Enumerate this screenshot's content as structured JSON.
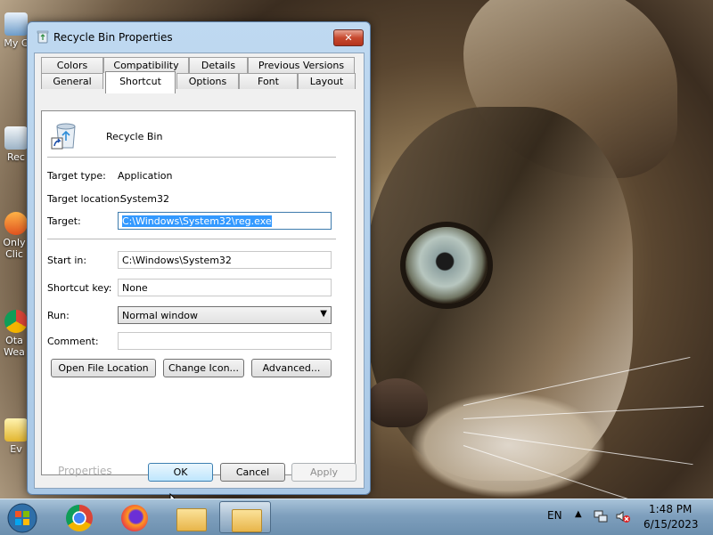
{
  "window": {
    "title": "Recycle Bin Properties",
    "close_label": "✕"
  },
  "tabs": {
    "row1": [
      "Colors",
      "Compatibility",
      "Details",
      "Previous Versions"
    ],
    "row2": [
      "General",
      "Shortcut",
      "Options",
      "Font",
      "Layout"
    ],
    "active": "Shortcut"
  },
  "shortcut": {
    "name": "Recycle Bin",
    "target_type_label": "Target type:",
    "target_type_value": "Application",
    "target_location_label": "Target location:",
    "target_location_value": "System32",
    "target_label": "Target:",
    "target_value": "C:\\Windows\\System32\\reg.exe",
    "start_in_label": "Start in:",
    "start_in_value": "C:\\Windows\\System32",
    "shortcut_key_label": "Shortcut key:",
    "shortcut_key_value": "None",
    "run_label": "Run:",
    "run_value": "Normal window",
    "comment_label": "Comment:",
    "comment_value": "",
    "open_file_location": "Open File Location",
    "change_icon": "Change Icon...",
    "advanced": "Advanced..."
  },
  "footer": {
    "properties_text": "Properties",
    "ok": "OK",
    "cancel": "Cancel",
    "apply": "Apply"
  },
  "desktop_icons": [
    {
      "label": "My C",
      "icon": "computer-icon"
    },
    {
      "label": "Rec",
      "icon": "recycle-bin-icon"
    },
    {
      "label": "Only Clic",
      "icon": "app-icon"
    },
    {
      "label": "Ota Wea",
      "icon": "chrome-icon"
    },
    {
      "label": "Ev",
      "icon": "shortcut-icon"
    }
  ],
  "taskbar": {
    "language": "EN",
    "time": "1:48 PM",
    "date": "6/15/2023"
  },
  "colors": {
    "selection": "#3399ff",
    "title_close": "#c7492f",
    "taskbar": "#7e9fbd"
  }
}
